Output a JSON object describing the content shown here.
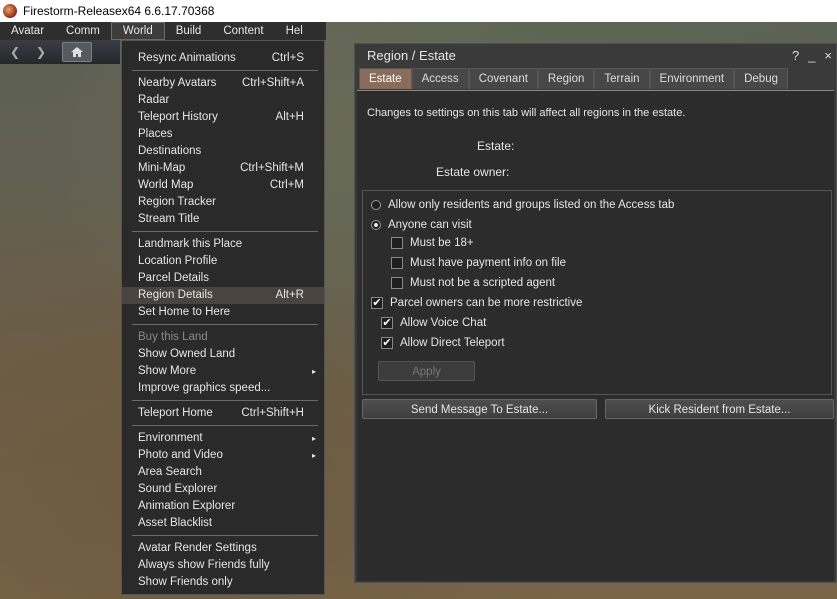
{
  "window": {
    "title": "Firestorm-Releasex64 6.6.17.70368",
    "icon": "firestorm-icon"
  },
  "menubar": {
    "items": [
      {
        "label": "Avatar"
      },
      {
        "label": "Comm"
      },
      {
        "label": "World",
        "active": true
      },
      {
        "label": "Build"
      },
      {
        "label": "Content"
      },
      {
        "label": "Hel"
      }
    ]
  },
  "navbar": {
    "back": "back-arrow-icon",
    "forward": "forward-arrow-icon",
    "home": "home-icon"
  },
  "world_menu": {
    "groups": [
      [
        {
          "label": "Resync Animations",
          "shortcut": "Ctrl+S"
        }
      ],
      [
        {
          "label": "Nearby Avatars",
          "shortcut": "Ctrl+Shift+A"
        },
        {
          "label": "Radar",
          "shortcut": ""
        },
        {
          "label": "Teleport History",
          "shortcut": "Alt+H"
        },
        {
          "label": "Places",
          "shortcut": ""
        },
        {
          "label": "Destinations",
          "shortcut": ""
        },
        {
          "label": "Mini-Map",
          "shortcut": "Ctrl+Shift+M"
        },
        {
          "label": "World Map",
          "shortcut": "Ctrl+M"
        },
        {
          "label": "Region Tracker",
          "shortcut": ""
        },
        {
          "label": "Stream Title",
          "shortcut": ""
        }
      ],
      [
        {
          "label": "Landmark this Place",
          "shortcut": ""
        },
        {
          "label": "Location Profile",
          "shortcut": ""
        },
        {
          "label": "Parcel Details",
          "shortcut": ""
        },
        {
          "label": "Region Details",
          "shortcut": "Alt+R",
          "highlight": true
        },
        {
          "label": "Set Home to Here",
          "shortcut": ""
        }
      ],
      [
        {
          "label": "Buy this Land",
          "shortcut": "",
          "disabled": true
        },
        {
          "label": "Show Owned Land",
          "shortcut": ""
        },
        {
          "label": "Show More",
          "shortcut": "",
          "submenu": true
        },
        {
          "label": "Improve graphics speed...",
          "shortcut": ""
        }
      ],
      [
        {
          "label": "Teleport Home",
          "shortcut": "Ctrl+Shift+H"
        }
      ],
      [
        {
          "label": "Environment",
          "shortcut": "",
          "submenu": true
        },
        {
          "label": "Photo and Video",
          "shortcut": "",
          "submenu": true
        },
        {
          "label": "Area Search",
          "shortcut": ""
        },
        {
          "label": "Sound Explorer",
          "shortcut": ""
        },
        {
          "label": "Animation Explorer",
          "shortcut": ""
        },
        {
          "label": "Asset Blacklist",
          "shortcut": ""
        }
      ],
      [
        {
          "label": "Avatar Render Settings",
          "shortcut": ""
        },
        {
          "label": "Always show Friends fully",
          "shortcut": ""
        },
        {
          "label": "Show Friends only",
          "shortcut": ""
        }
      ]
    ]
  },
  "floater": {
    "title": "Region / Estate",
    "help": "?",
    "minimize": "_",
    "close": "×",
    "tabs": [
      "Estate",
      "Access",
      "Covenant",
      "Region",
      "Terrain",
      "Environment",
      "Debug"
    ],
    "active_tab": "Estate",
    "notice": "Changes to settings on this tab will affect all regions in the estate.",
    "estate_label": "Estate:",
    "estate_value": "",
    "owner_label": "Estate owner:",
    "owner_value": "",
    "radio_residents": {
      "label": "Allow only residents and groups listed on the Access tab",
      "selected": false
    },
    "radio_anyone": {
      "label": "Anyone can visit",
      "selected": true
    },
    "check_18": {
      "label": "Must be 18+",
      "checked": false
    },
    "check_payment": {
      "label": "Must have payment info on file",
      "checked": false
    },
    "check_scripted": {
      "label": "Must not be a scripted agent",
      "checked": false
    },
    "check_parcel": {
      "label": "Parcel owners can be more restrictive",
      "checked": true
    },
    "check_voice": {
      "label": "Allow Voice Chat",
      "checked": true
    },
    "check_teleport": {
      "label": "Allow Direct Teleport",
      "checked": true
    },
    "apply_button": "Apply",
    "send_message_button": "Send Message To Estate...",
    "kick_button": "Kick Resident from Estate..."
  }
}
